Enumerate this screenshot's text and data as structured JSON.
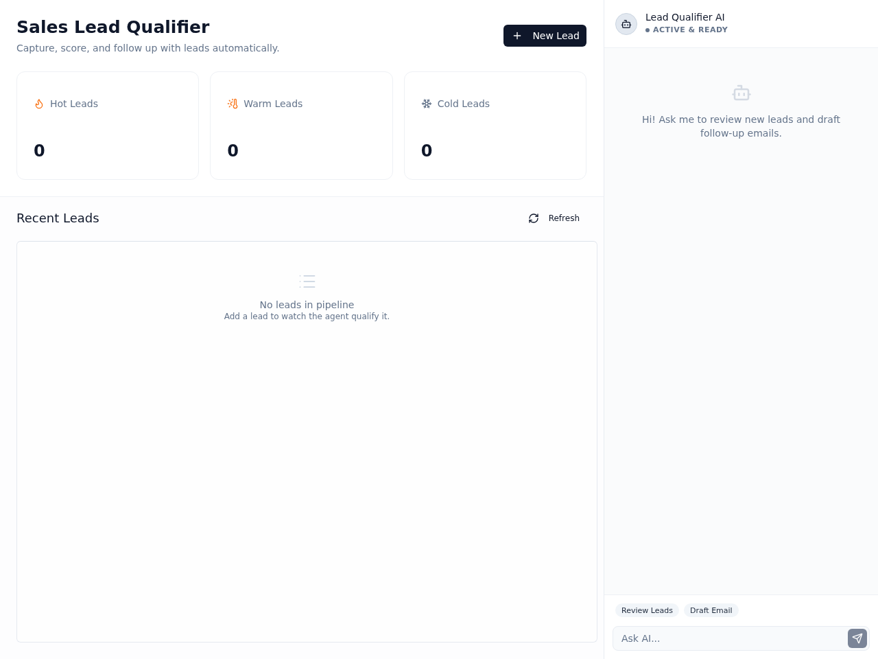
{
  "header": {
    "title": "Sales Lead Qualifier",
    "subtitle": "Capture, score, and follow up with leads automatically.",
    "new_lead_button": "New Lead"
  },
  "stats": [
    {
      "kind": "hot",
      "label": "Hot Leads",
      "value": "0"
    },
    {
      "kind": "warm",
      "label": "Warm Leads",
      "value": "0"
    },
    {
      "kind": "cold",
      "label": "Cold Leads",
      "value": "0"
    }
  ],
  "recent_leads": {
    "title": "Recent Leads",
    "refresh_button": "Refresh",
    "empty_state": {
      "title": "No leads in pipeline",
      "hint": "Add a lead to watch the agent qualify it."
    }
  },
  "assistant": {
    "name": "Lead Qualifier AI",
    "status": "ACTIVE & READY",
    "greeting": "Hi! Ask me to review new leads and draft follow-up emails.",
    "quick_actions": [
      "Review Leads",
      "Draft Email"
    ],
    "input": {
      "placeholder": "Ask AI..."
    }
  }
}
